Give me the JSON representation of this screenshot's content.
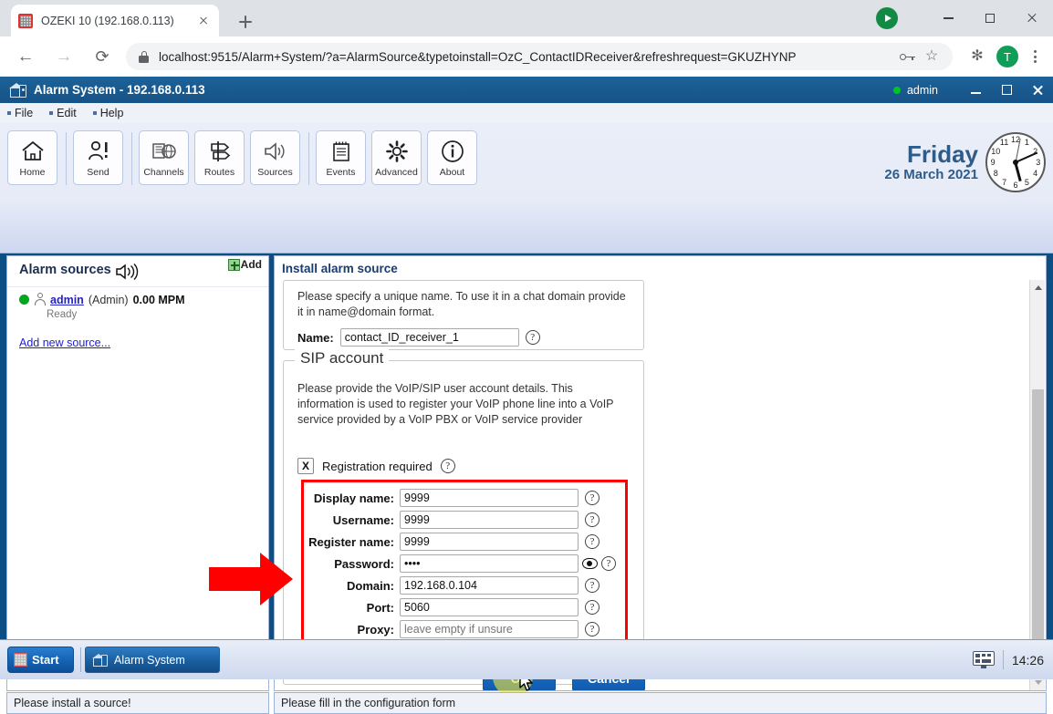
{
  "browser": {
    "tab_title": "OZEKI 10 (192.168.0.113)",
    "url": "localhost:9515/Alarm+System/?a=AlarmSource&typetoinstall=OzC_ContactIDReceiver&refreshrequest=GKUZHYNP",
    "avatar_letter": "T",
    "icons": {
      "back": "←",
      "forward": "→",
      "reload": "⟳",
      "star": "☆",
      "extensions": "✻"
    }
  },
  "app": {
    "title": "Alarm System - 192.168.0.113",
    "user": "admin",
    "menu": [
      "File",
      "Edit",
      "Help"
    ],
    "toolbar": [
      {
        "label": "Home"
      },
      {
        "label": "Send"
      },
      {
        "label": "Channels"
      },
      {
        "label": "Routes"
      },
      {
        "label": "Sources"
      },
      {
        "label": "Events"
      },
      {
        "label": "Advanced"
      },
      {
        "label": "About"
      }
    ],
    "clock": {
      "day": "Friday",
      "date": "26 March 2021",
      "numbers": [
        "12",
        "1",
        "2",
        "3",
        "4",
        "5",
        "6",
        "7",
        "8",
        "9",
        "10",
        "11"
      ]
    }
  },
  "sidebar": {
    "title": "Alarm sources",
    "add_label": "Add",
    "source": {
      "name": "admin",
      "role": "(Admin)",
      "rate": "0.00 MPM",
      "status": "Ready"
    },
    "add_new_source": "Add new source..."
  },
  "content": {
    "title": "Install alarm source",
    "name_panel": {
      "description": "Please specify a unique name. To use it in a chat domain provide it in name@domain format.",
      "label": "Name:",
      "value": "contact_ID_receiver_1"
    },
    "sip_panel": {
      "legend": "SIP account",
      "description": "Please provide the VoIP/SIP user account details. This information is used to register your VoIP phone line into a VoIP service provided by a VoIP PBX or VoIP service provider",
      "registration_required": {
        "label": "Registration required",
        "checked_mark": "X"
      },
      "fields": [
        {
          "label": "Display name:",
          "value": "9999",
          "placeholder": "",
          "type": "text"
        },
        {
          "label": "Username:",
          "value": "9999",
          "placeholder": "",
          "type": "text"
        },
        {
          "label": "Register name:",
          "value": "9999",
          "placeholder": "",
          "type": "text"
        },
        {
          "label": "Password:",
          "value": "••••",
          "placeholder": "",
          "type": "password"
        },
        {
          "label": "Domain:",
          "value": "192.168.0.104",
          "placeholder": "",
          "type": "text"
        },
        {
          "label": "Port:",
          "value": "5060",
          "placeholder": "",
          "type": "text"
        },
        {
          "label": "Proxy:",
          "value": "",
          "placeholder": "leave empty if unsure",
          "type": "text"
        }
      ]
    },
    "buttons": {
      "ok": "Ok",
      "cancel": "Cancel"
    },
    "help_glyph": "?"
  },
  "status": {
    "left": "Please install a source!",
    "right": "Please fill in the configuration form"
  },
  "taskbar": {
    "start": "Start",
    "task": "Alarm System",
    "clock": "14:26"
  },
  "colors": {
    "accent_blue": "#1668bd",
    "titlebar_blue": "#165286",
    "highlight_red": "#ff0000",
    "status_green": "#00a81e",
    "link_blue": "#2222cc"
  }
}
